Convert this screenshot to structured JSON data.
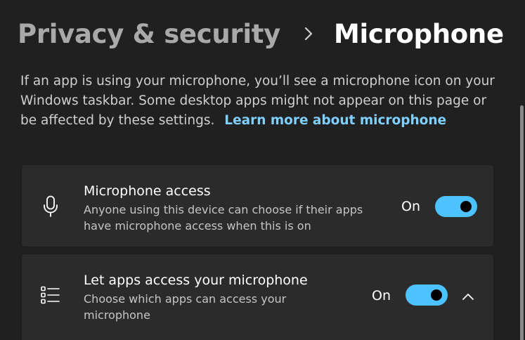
{
  "breadcrumb": {
    "parent": "Privacy & security",
    "separator_icon": "chevron-right-icon",
    "current": "Microphone"
  },
  "description": {
    "text": "If an app is using your microphone, you’ll see a microphone icon on your Windows taskbar. Some desktop apps might not appear on this page or be affected by these settings.",
    "link": "Learn more about microphone"
  },
  "settings": [
    {
      "icon": "microphone-icon",
      "title": "Microphone access",
      "subtitle": "Anyone using this device can choose if their apps have microphone access when this is on",
      "state_label": "On",
      "toggle_on": true
    },
    {
      "icon": "app-list-icon",
      "title": "Let apps access your microphone",
      "subtitle": "Choose which apps can access your microphone",
      "state_label": "On",
      "toggle_on": true,
      "expand_icon": "chevron-up-icon"
    }
  ],
  "colors": {
    "background": "#202020",
    "card": "#2b2b2b",
    "accent": "#4cc2ff",
    "link": "#7fd0ff"
  }
}
